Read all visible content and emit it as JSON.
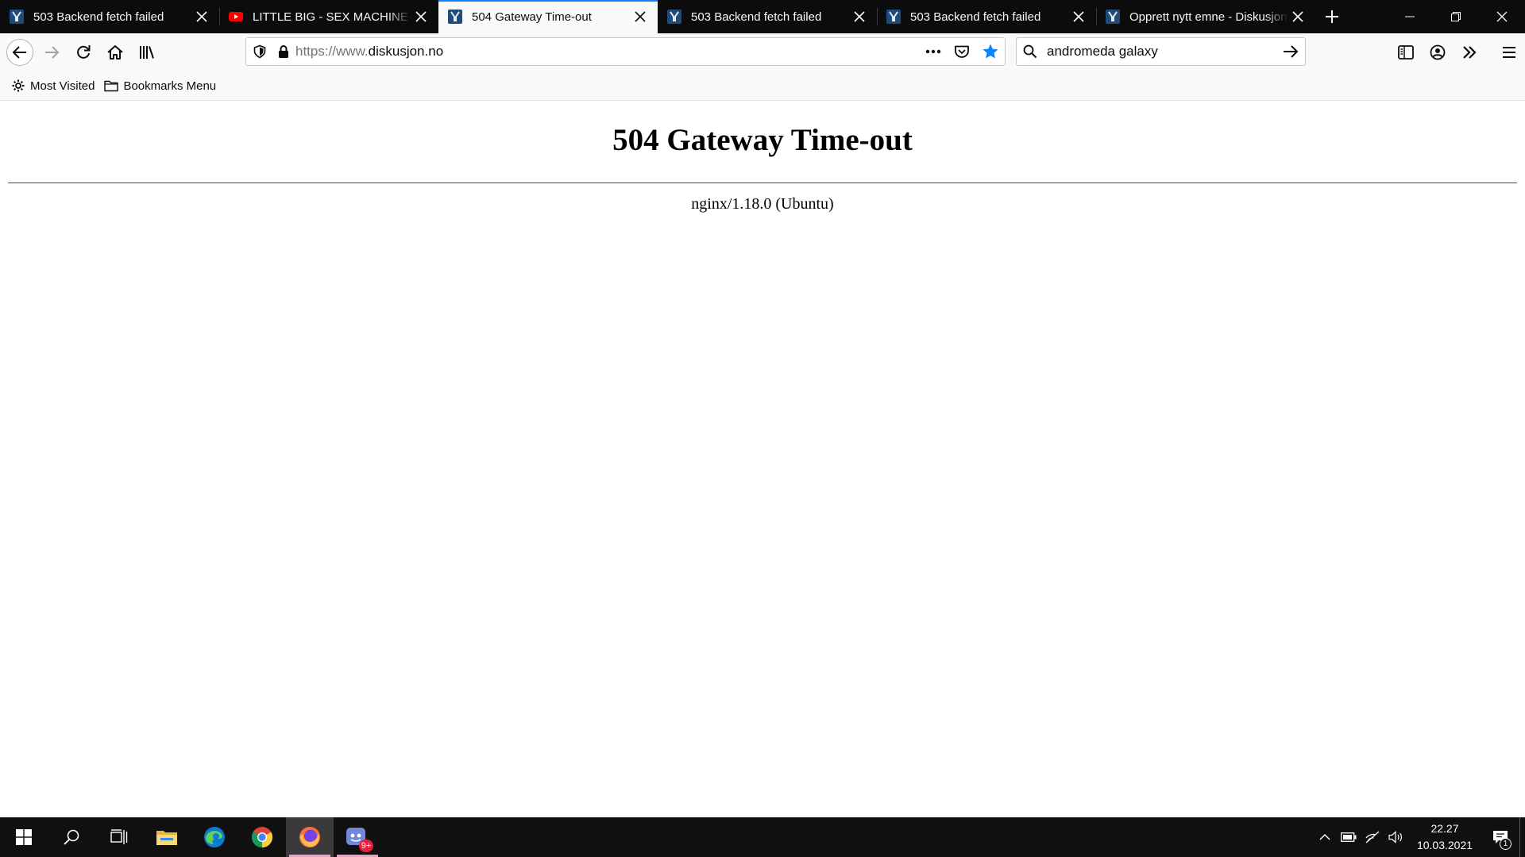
{
  "browser": {
    "tabs": [
      {
        "title": "503 Backend fetch failed",
        "favicon": "diskusjon-favicon",
        "active": false
      },
      {
        "title": "LITTLE BIG - SEX MACHINE (Official Music Video)",
        "favicon": "youtube-favicon",
        "active": false
      },
      {
        "title": "504 Gateway Time-out",
        "favicon": "diskusjon-favicon",
        "active": true
      },
      {
        "title": "503 Backend fetch failed",
        "favicon": "diskusjon-favicon",
        "active": false
      },
      {
        "title": "503 Backend fetch failed",
        "favicon": "diskusjon-favicon",
        "active": false
      },
      {
        "title": "Opprett nytt emne - Diskusjon.no",
        "favicon": "diskusjon-favicon",
        "active": false
      }
    ],
    "url": {
      "protocol": "https://www.",
      "host": "diskusjon.no"
    },
    "search": {
      "value": "andromeda galaxy"
    },
    "bookmarks": {
      "most_visited": "Most Visited",
      "bookmarks_menu": "Bookmarks Menu"
    },
    "colors": {
      "accent": "#0a84ff",
      "tab_strip": "#0c0c0d",
      "toolbar": "#f9f9fa"
    }
  },
  "page": {
    "heading": "504 Gateway Time-out",
    "server_signature": "nginx/1.18.0 (Ubuntu)"
  },
  "taskbar": {
    "apps": [
      "start-button",
      "search-icon",
      "task-view-icon",
      "file-explorer-icon",
      "edge-icon",
      "chrome-icon",
      "firefox-icon",
      "discord-icon"
    ],
    "discord_badge": "9+",
    "clock": {
      "time": "22.27",
      "date": "10.03.2021"
    },
    "notification_count": "1"
  }
}
